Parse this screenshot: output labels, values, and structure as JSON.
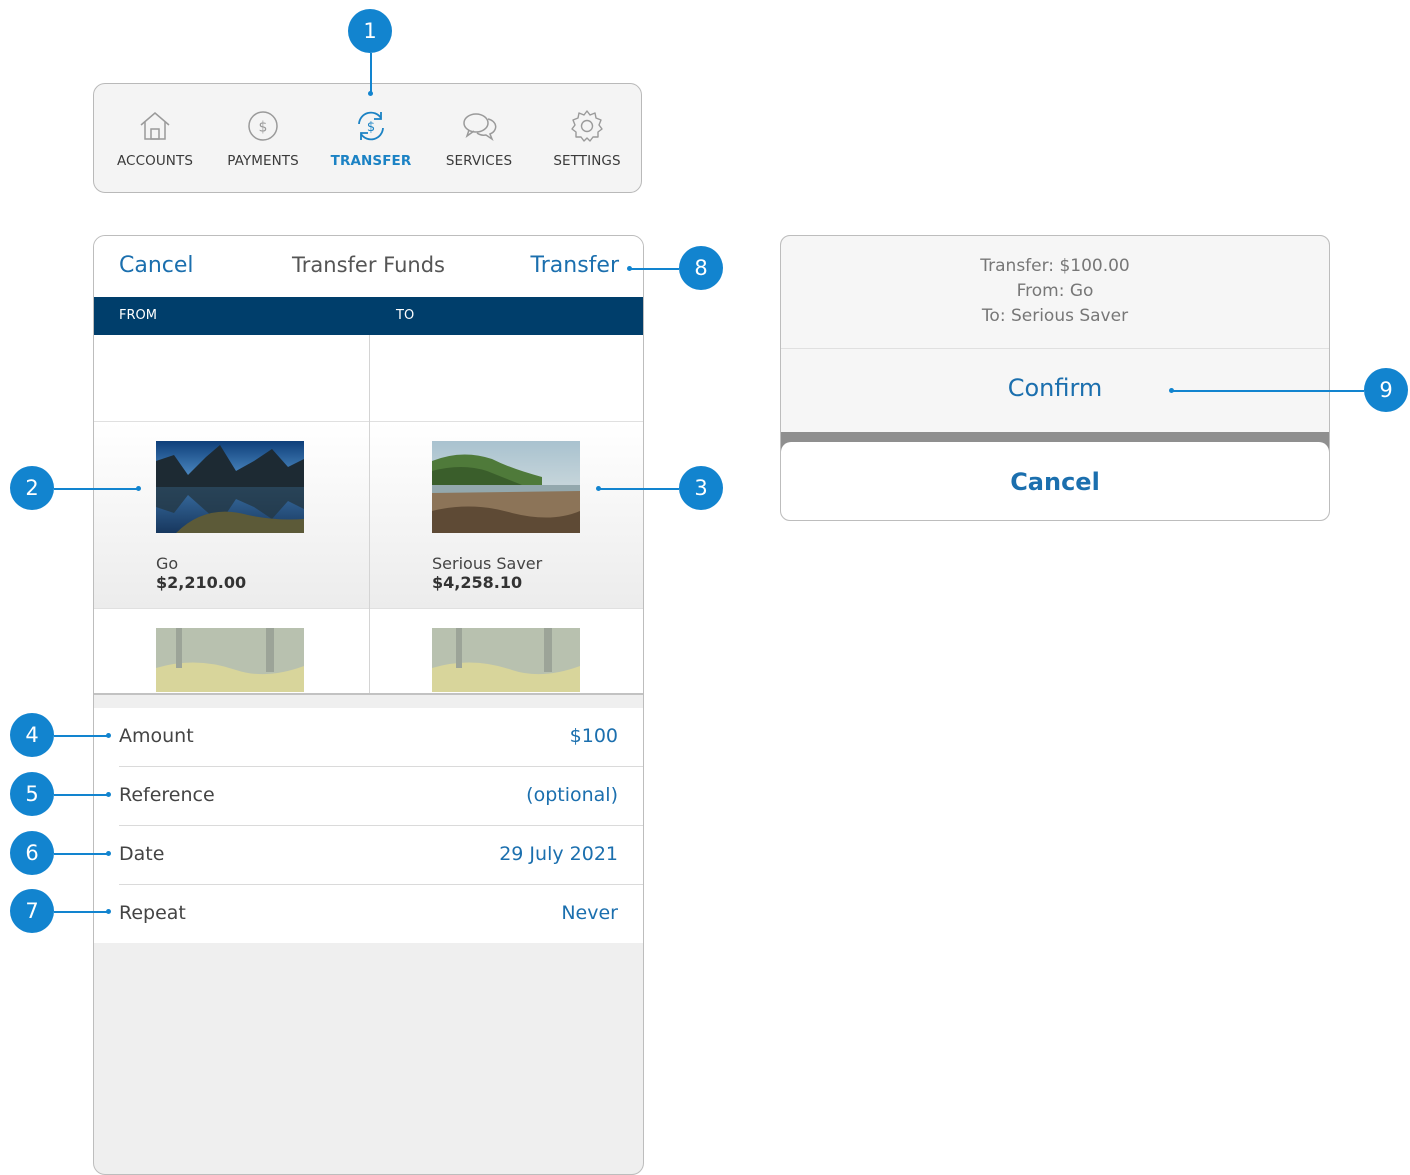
{
  "tabbar": {
    "items": [
      {
        "label": "ACCOUNTS",
        "icon": "house-icon"
      },
      {
        "label": "PAYMENTS",
        "icon": "dollar-circle-icon"
      },
      {
        "label": "TRANSFER",
        "icon": "transfer-dollar-icon",
        "active": true
      },
      {
        "label": "SERVICES",
        "icon": "chat-bubbles-icon"
      },
      {
        "label": "SETTINGS",
        "icon": "gear-icon"
      }
    ],
    "active_color": "#1b82c4"
  },
  "transfer_screen": {
    "nav": {
      "cancel": "Cancel",
      "title": "Transfer Funds",
      "transfer": "Transfer"
    },
    "header": {
      "from": "FROM",
      "to": "TO",
      "color": "#003e6b"
    },
    "from_account": {
      "name": "Go",
      "balance": "$2,210.00",
      "image": "mountain-lake-photo"
    },
    "to_account": {
      "name": "Serious Saver",
      "balance": "$4,258.10",
      "image": "coastal-beach-photo"
    },
    "rows": [
      {
        "label": "Amount",
        "value": "$100"
      },
      {
        "label": "Reference",
        "value": "(optional)"
      },
      {
        "label": "Date",
        "value": "29 July 2021"
      },
      {
        "label": "Repeat",
        "value": "Never"
      }
    ]
  },
  "confirm_sheet": {
    "line1": "Transfer: $100.00",
    "line2": "From: Go",
    "line3": "To: Serious Saver",
    "confirm": "Confirm",
    "cancel": "Cancel"
  },
  "callouts": [
    "1",
    "2",
    "3",
    "4",
    "5",
    "6",
    "7",
    "8",
    "9"
  ],
  "accent_color": "#1284cf"
}
